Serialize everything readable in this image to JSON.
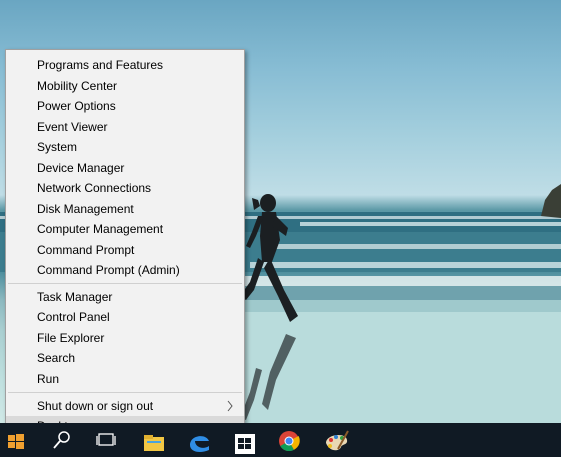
{
  "menu": {
    "items": [
      {
        "label": "Programs and Features"
      },
      {
        "label": "Mobility Center"
      },
      {
        "label": "Power Options"
      },
      {
        "label": "Event Viewer"
      },
      {
        "label": "System"
      },
      {
        "label": "Device Manager"
      },
      {
        "label": "Network Connections"
      },
      {
        "label": "Disk Management"
      },
      {
        "label": "Computer Management"
      },
      {
        "label": "Command Prompt"
      },
      {
        "label": "Command Prompt (Admin)"
      },
      {
        "label": "Task Manager"
      },
      {
        "label": "Control Panel"
      },
      {
        "label": "File Explorer"
      },
      {
        "label": "Search"
      },
      {
        "label": "Run"
      },
      {
        "label": "Shut down or sign out"
      },
      {
        "label": "Desktop"
      }
    ],
    "hovered_item": "Desktop"
  },
  "taskbar": {
    "buttons": [
      {
        "icon": "windows-start-icon"
      },
      {
        "icon": "search-icon"
      },
      {
        "icon": "task-view-icon"
      },
      {
        "icon": "store-icon"
      },
      {
        "icon": "edge-icon"
      },
      {
        "icon": "windows-store-icon"
      },
      {
        "icon": "chrome-icon"
      },
      {
        "icon": "paint-icon"
      }
    ]
  },
  "colors": {
    "menu_background": "#f2f2f2",
    "menu_hover": "#dadada",
    "taskbar": "#101a24"
  }
}
